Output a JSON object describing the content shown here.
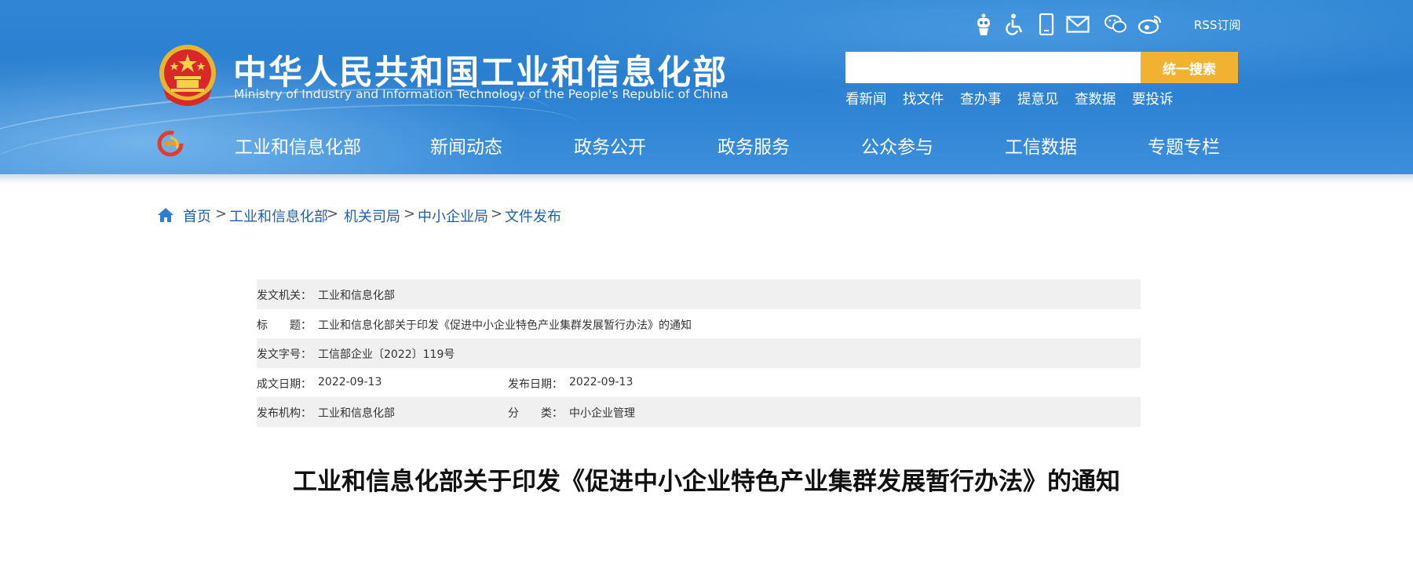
{
  "header": {
    "title": "中华人民共和国工业和信息化部",
    "subtitle": "Ministry of Industry and Information Technology of the People's Republic of China",
    "icons": [
      "robot-icon",
      "accessibility-icon",
      "mobile-icon",
      "mail-icon",
      "wechat-icon",
      "weibo-icon",
      "rss-icon"
    ],
    "rss_label": "RSS订阅",
    "search": {
      "placeholder": "",
      "button_label": "统一搜索"
    },
    "quick_links": [
      "看新闻",
      "找文件",
      "查办事",
      "提意见",
      "查数据",
      "要投诉"
    ],
    "nav": [
      "工业和信息化部",
      "新闻动态",
      "政务公开",
      "政务服务",
      "公众参与",
      "工信数据",
      "专题专栏"
    ],
    "colors": {
      "header_blue": "#2f86d4",
      "search_button": "#f2b231"
    }
  },
  "breadcrumb": [
    "首页",
    "工业和信息化部",
    "机关司局",
    "中小企业局",
    "文件发布"
  ],
  "breadcrumb_separator": ">",
  "meta": {
    "issuer_label": "发文机关：",
    "issuer": "工业和信息化部",
    "title_label": "标　　题：",
    "title": "工业和信息化部关于印发《促进中小企业特色产业集群发展暂行办法》的通知",
    "doc_no_label": "发文字号：",
    "doc_no": "工信部企业〔2022〕119号",
    "written_date_label": "成文日期：",
    "written_date": "2022-09-13",
    "publish_date_label": "发布日期：",
    "publish_date": "2022-09-13",
    "publisher_label": "发布机构：",
    "publisher": "工业和信息化部",
    "category_label": "分　　类：",
    "category": "中小企业管理"
  },
  "document": {
    "title": "工业和信息化部关于印发《促进中小企业特色产业集群发展暂行办法》的通知"
  }
}
